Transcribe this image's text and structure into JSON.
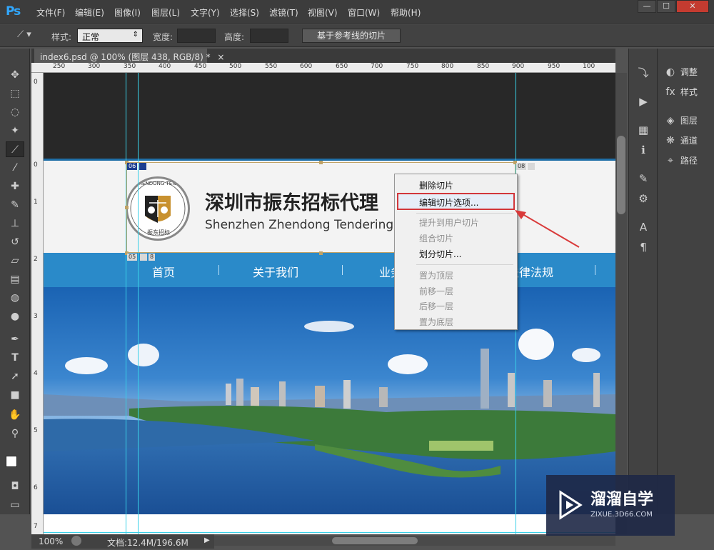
{
  "menubar": {
    "logo": "Ps",
    "items": [
      "文件(F)",
      "编辑(E)",
      "图像(I)",
      "图层(L)",
      "文字(Y)",
      "选择(S)",
      "滤镜(T)",
      "视图(V)",
      "窗口(W)",
      "帮助(H)"
    ],
    "window_buttons": [
      "—",
      "☐",
      "✕"
    ]
  },
  "options": {
    "style_label": "样式:",
    "style_value": "正常",
    "width_label": "宽度:",
    "height_label": "高度:",
    "guide_slice_button": "基于参考线的切片"
  },
  "document": {
    "tab_title": "index6.psd @ 100% (图层 438, RGB/8) *",
    "close_glyph": "×"
  },
  "rulers": {
    "horizontal": [
      "250",
      "300",
      "350",
      "400",
      "450",
      "500",
      "550",
      "600",
      "650",
      "700",
      "750",
      "800",
      "850",
      "900",
      "950",
      "100"
    ],
    "vertical": [
      "0",
      "0",
      "1",
      "2",
      "3",
      "4",
      "5",
      "6",
      "7"
    ]
  },
  "page": {
    "site_title": "深圳市振东招标代理",
    "site_subtitle": "Shenzhen Zhendong Tendering",
    "logo_text": "ZHENDONG TENDERING",
    "logo_bottom": "振东招标",
    "nav": [
      "首页",
      "关于我们",
      "业务",
      "法律法规"
    ]
  },
  "slice_tags": {
    "tag1": "06",
    "tag2": "05",
    "tag3": "8",
    "tag4": "08"
  },
  "context_menu": {
    "items": [
      {
        "label": "删除切片",
        "enabled": true
      },
      {
        "label": "编辑切片选项...",
        "enabled": true,
        "highlighted": true
      },
      {
        "label": "提升到用户切片",
        "enabled": false
      },
      {
        "label": "组合切片",
        "enabled": false
      },
      {
        "label": "划分切片...",
        "enabled": true
      },
      {
        "label": "置为顶层",
        "enabled": false
      },
      {
        "label": "前移一层",
        "enabled": false
      },
      {
        "label": "后移一层",
        "enabled": false
      },
      {
        "label": "置为底层",
        "enabled": false
      }
    ]
  },
  "status": {
    "zoom": "100%",
    "doc_info": "文档:12.4M/196.6M"
  },
  "panels": {
    "right": [
      "调整",
      "样式",
      "图层",
      "通道",
      "路径"
    ]
  },
  "watermark": {
    "title": "溜溜自学",
    "url": "ZIXUE.3D66.COM"
  },
  "colors": {
    "ps_blue": "#31a8ff",
    "nav_blue": "#2a8ac9",
    "guide_cyan": "#39d0e7",
    "highlight_red": "#d2373b"
  }
}
